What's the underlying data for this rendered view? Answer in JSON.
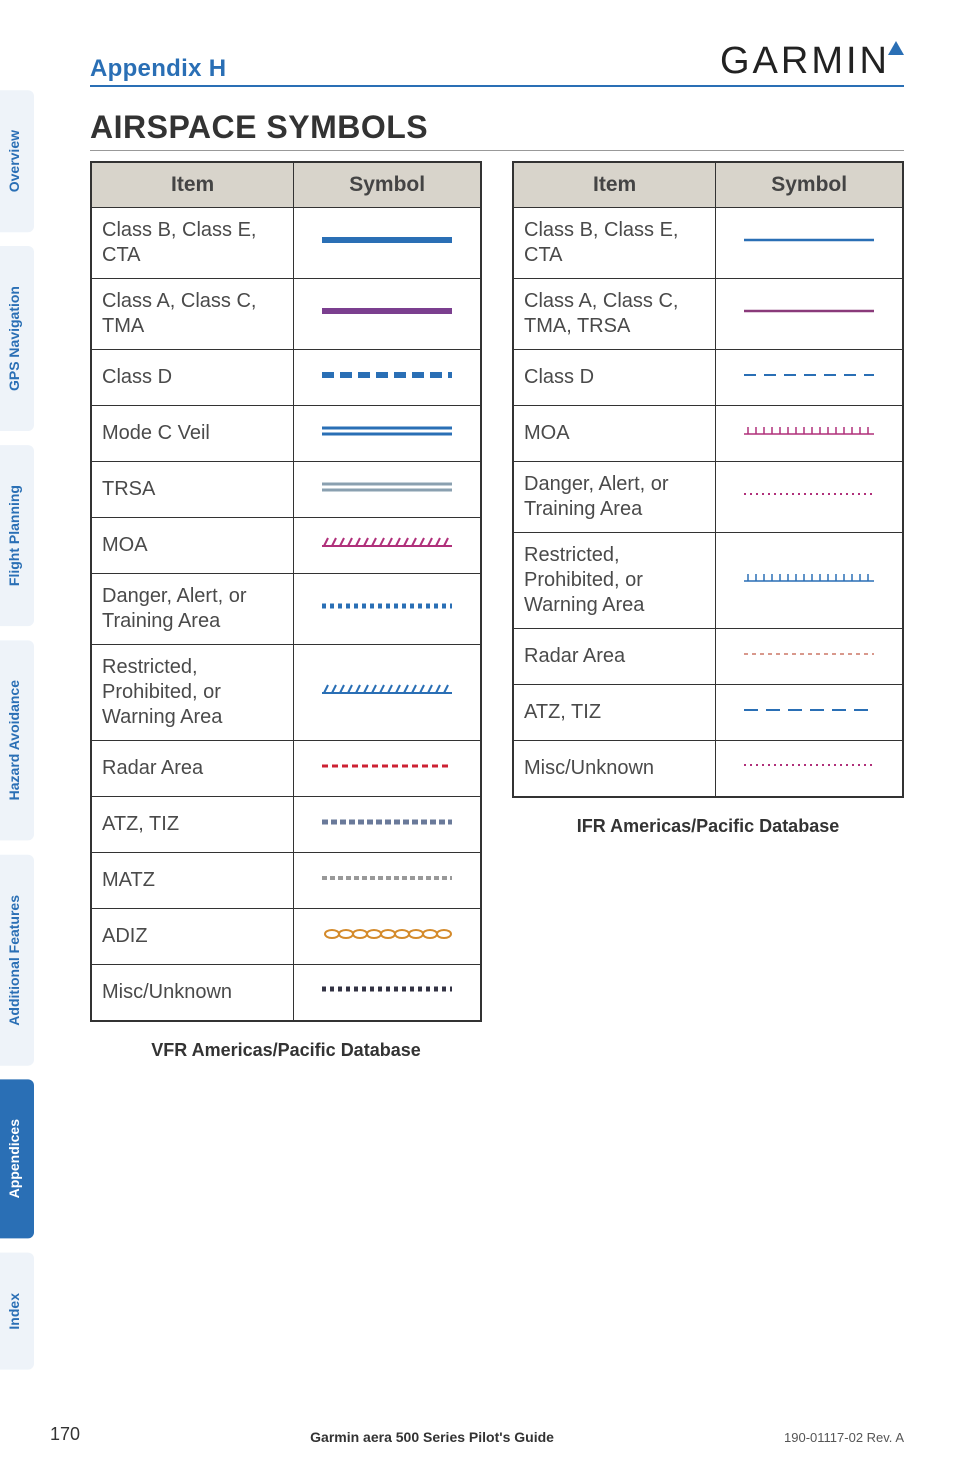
{
  "header": {
    "appendix": "Appendix H",
    "brand": "GARMIN"
  },
  "section_title": "AIRSPACE SYMBOLS",
  "columns": {
    "item": "Item",
    "symbol": "Symbol"
  },
  "vfr": {
    "caption": "VFR Americas/Pacific Database",
    "rows": [
      {
        "item": "Class B, Class E, CTA",
        "symbol": "solid-blue-thick"
      },
      {
        "item": "Class A, Class C, TMA",
        "symbol": "solid-magenta-thick"
      },
      {
        "item": "Class D",
        "symbol": "dash-blue-boxes"
      },
      {
        "item": "Mode C Veil",
        "symbol": "double-blue"
      },
      {
        "item": "TRSA",
        "symbol": "double-gray"
      },
      {
        "item": "MOA",
        "symbol": "hatch-magenta"
      },
      {
        "item": "Danger, Alert, or Training Area",
        "symbol": "dot-blue"
      },
      {
        "item": "Restricted, Prohibited, or Warning Area",
        "symbol": "hatch-blue"
      },
      {
        "item": "Radar Area",
        "symbol": "dash-red-small"
      },
      {
        "item": "ATZ, TIZ",
        "symbol": "dash-bluegray"
      },
      {
        "item": "MATZ",
        "symbol": "dash-gray-small"
      },
      {
        "item": "ADIZ",
        "symbol": "chain-orange"
      },
      {
        "item": "Misc/Unknown",
        "symbol": "dot-dark"
      }
    ]
  },
  "ifr": {
    "caption": "IFR Americas/Pacific Database",
    "rows": [
      {
        "item": "Class B, Class E, CTA",
        "symbol": "solid-blue-thin"
      },
      {
        "item": "Class A, Class C, TMA, TRSA",
        "symbol": "solid-magenta-thin"
      },
      {
        "item": "Class D",
        "symbol": "dash-blue-thin"
      },
      {
        "item": "MOA",
        "symbol": "tick-magenta"
      },
      {
        "item": "Danger, Alert, or Training Area",
        "symbol": "dot-magenta-small"
      },
      {
        "item": "Restricted, Prohibited, or Warning Area",
        "symbol": "tick-blue"
      },
      {
        "item": "Radar Area",
        "symbol": "dash-red-tiny"
      },
      {
        "item": "ATZ, TIZ",
        "symbol": "dash-blue-long"
      },
      {
        "item": "Misc/Unknown",
        "symbol": "dot-magenta-small2"
      }
    ]
  },
  "tabs": [
    {
      "label": "Overview",
      "active": false
    },
    {
      "label": "GPS Navigation",
      "active": false
    },
    {
      "label": "Flight Planning",
      "active": false
    },
    {
      "label": "Hazard Avoidance",
      "active": false
    },
    {
      "label": "Additional Features",
      "active": false
    },
    {
      "label": "Appendices",
      "active": true
    },
    {
      "label": "Index",
      "active": false
    }
  ],
  "footer": {
    "page": "170",
    "guide": "Garmin aera 500 Series Pilot's Guide",
    "rev": "190-01117-02  Rev. A"
  }
}
